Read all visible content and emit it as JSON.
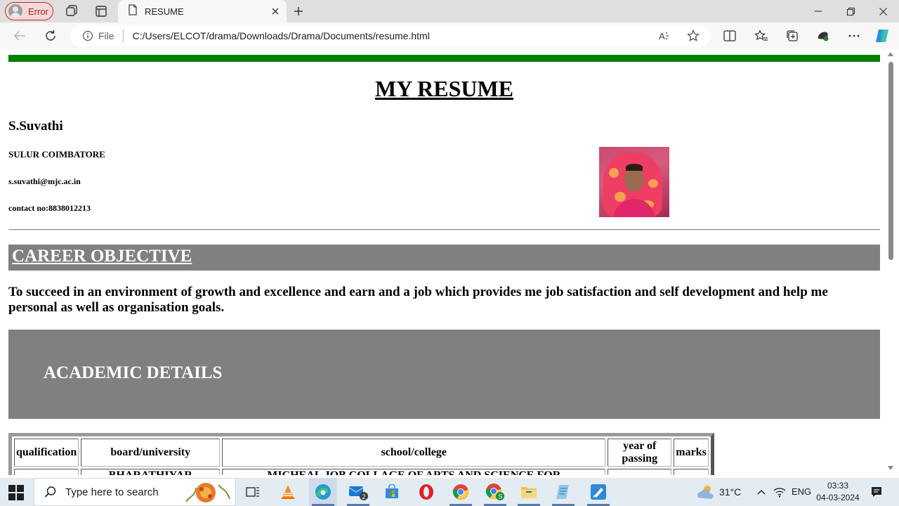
{
  "browser": {
    "profile_label": "Error",
    "tab_title": "RESUME",
    "address": {
      "scheme_label": "File",
      "url": "C:/Users/ELCOT/drama/Downloads/Drama/Documents/resume.html"
    }
  },
  "page": {
    "title": "MY RESUME",
    "name": "S.Suvathi",
    "address": "SULUR COIMBATORE",
    "email": "s.suvathi@mjc.ac.in",
    "contact": "contact no:8838012213",
    "career_heading": "CAREER OBJECTIVE",
    "objective": "To succeed in an environment of growth and excellence and earn and a job which provides me job satisfaction and self development and help me personal as well as organisation goals.",
    "academic_heading": "ACADEMIC DETAILS",
    "table": {
      "headers": [
        "qualification",
        "board/university",
        "school/college",
        "year of passing",
        "marks"
      ],
      "row1": [
        "",
        "BHARATHIYAR",
        "MICHEAL JOB COLLAGE OF ARTS AND SCIENCE FOR",
        "",
        ""
      ]
    }
  },
  "taskbar": {
    "search_placeholder": "Type here to search",
    "mail_badge": "2",
    "weather": "31°C",
    "language": "ENG",
    "time": "03:33",
    "date": "04-03-2024"
  },
  "colors": {
    "accent_bar": "#008000",
    "section_box": "#808080",
    "profile_error": "#c62828"
  }
}
